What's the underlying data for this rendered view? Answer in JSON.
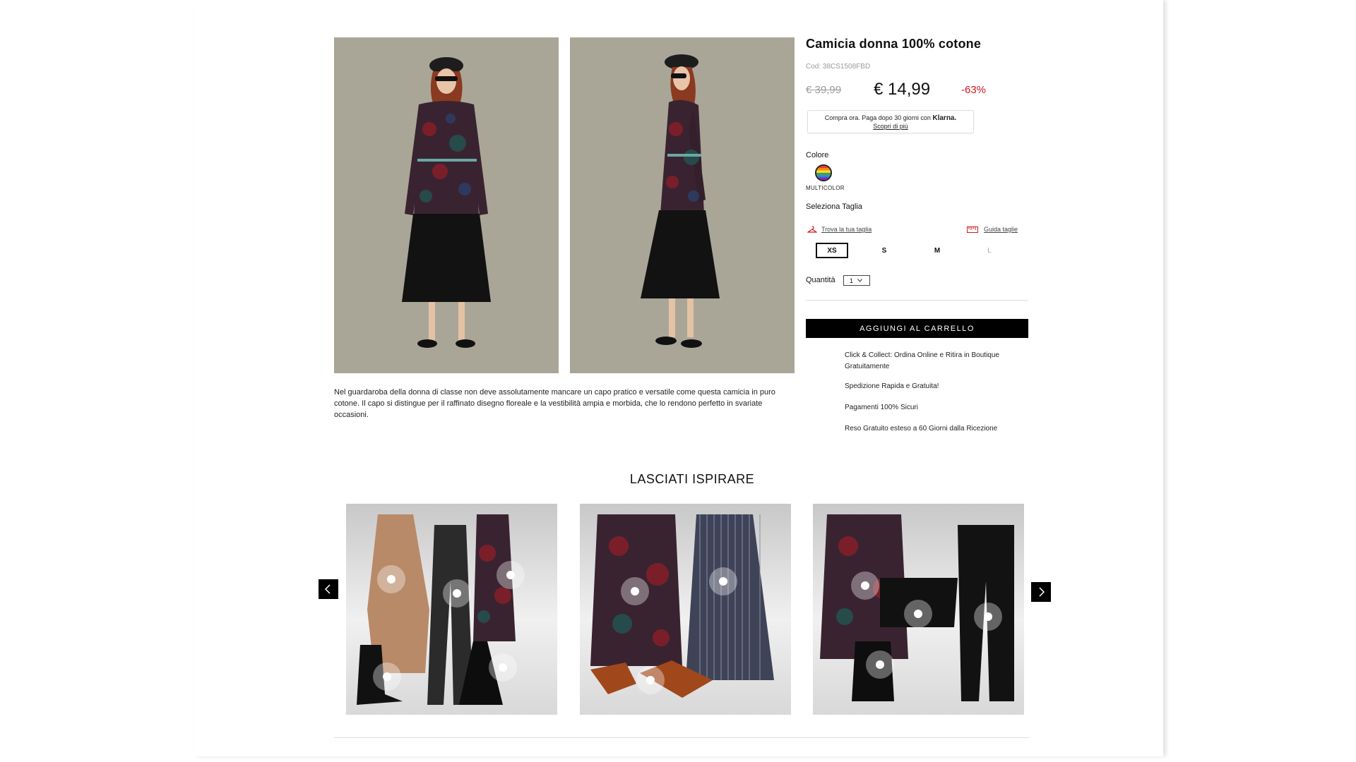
{
  "product": {
    "title": "Camicia donna 100% cotone",
    "code": "Cod: 38CS1508FBD",
    "old_price": "€ 39,99",
    "price": "€ 14,99",
    "discount": "-63%"
  },
  "klarna": {
    "text": "Compra ora. Paga dopo 30 giorni con",
    "brand": "Klarna.",
    "link": "Scopri di più"
  },
  "color": {
    "label": "Colore",
    "selected": "MULTICOLOR"
  },
  "size": {
    "label": "Seleziona Taglia",
    "find_link": "Trova la tua taglia",
    "guide_link": "Guida taglie",
    "options": [
      "XS",
      "S",
      "M",
      "L"
    ],
    "selected": "XS"
  },
  "quantity": {
    "label": "Quantità",
    "value": "1"
  },
  "cart_button": "AGGIUNGI AL CARRELLO",
  "benefits": [
    "Click & Collect: Ordina Online e Ritira in Boutique Gratuitamente",
    "Spedizione Rapida e Gratuita!",
    "Pagamenti 100% Sicuri",
    "Reso Gratuito esteso a 60 Giorni dalla Ricezione"
  ],
  "description": "Nel guardaroba della donna di classe non deve assolutamente mancare un capo pratico e versatile come questa camicia in puro cotone. Il capo si distingue per il raffinato disegno floreale e la vestibilità ampia e morbida, che lo rendono perfetto in svariate occasioni.",
  "inspiration": {
    "title": "LASCIATI ISPIRARE"
  },
  "colors": {
    "discount": "#d0181f",
    "button": "#000000",
    "photo_bg": "#a8a596"
  }
}
